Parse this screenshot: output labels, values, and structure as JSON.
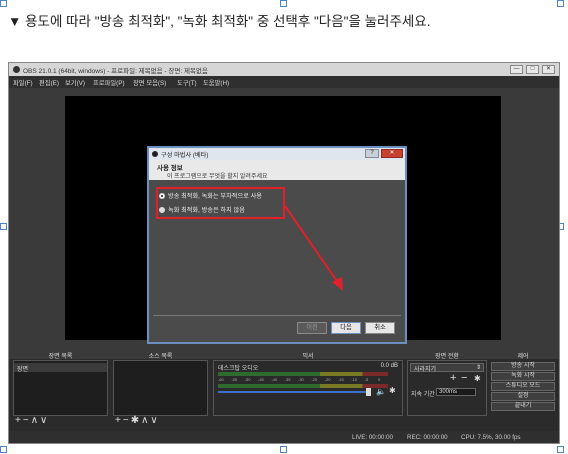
{
  "instruction": "▼ 용도에 따라 \"방송 최적화\", \"녹화 최적화\" 중 선택후 \"다음\"을 눌러주세요.",
  "window": {
    "title": "OBS 21.0.1 (64bit, windows) - 프로파일: 제목없음 - 장면: 제목없음",
    "buttons": [
      "—",
      "□",
      "✕"
    ]
  },
  "menu": [
    "파일(F)",
    "편집(E)",
    "보기(V)",
    "프로파일(P)",
    "장면 모음(S)",
    "도구(T)",
    "도움말(H)"
  ],
  "dialog": {
    "title": "구성 마법사 (베타)",
    "help": "?",
    "close": "✕",
    "heading": "사용 정보",
    "subheading": "이 프로그램으로 무엇을 할지 알려주세요",
    "options": [
      {
        "label": "방송 최적화, 녹화는 부차적으로 사용",
        "selected": true
      },
      {
        "label": "녹화 최적화, 방송은 하지 않음",
        "selected": false
      }
    ],
    "back_label": "이전",
    "next_label": "다음",
    "cancel_label": "취소"
  },
  "docks": {
    "scenes": "장면 목록",
    "sources": "소스 목록",
    "mixer": "믹서",
    "transitions": "장면 전환",
    "controls": "제어"
  },
  "scenes_list": [
    "장면"
  ],
  "mixer": {
    "channel": "데스크탑 오디오",
    "level": "0.0 dB",
    "scale": [
      "-60",
      "-55",
      "-50",
      "-45",
      "-40",
      "-35",
      "-30",
      "-25",
      "-20",
      "-15",
      "-10",
      "-5",
      "0"
    ]
  },
  "transitions": {
    "type": "사라지기",
    "duration_label": "지속 기간",
    "duration_value": "300ms"
  },
  "controls": [
    "방송 시작",
    "녹화 시작",
    "스튜디오 모드",
    "설정",
    "끝내기"
  ],
  "status": {
    "live": "LIVE: 00:00:00",
    "rec": "REC: 00:00:00",
    "cpu": "CPU: 7.5%, 30.00 fps"
  },
  "colors": {
    "highlight": "#e0202a",
    "dialog_border": "#6a8fc0"
  }
}
